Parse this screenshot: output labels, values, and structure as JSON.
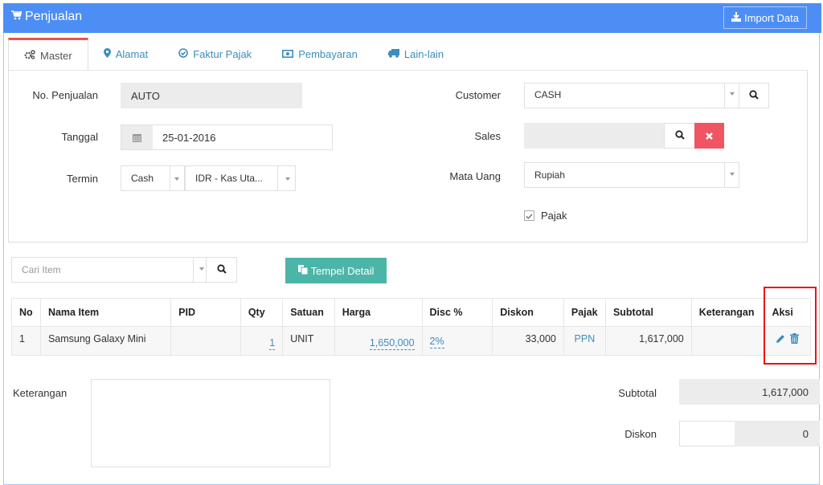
{
  "header": {
    "title": "Penjualan",
    "title_icon": "cart-icon",
    "import_button": "Import Data",
    "import_icon": "download-icon",
    "color": "#4d8ef5"
  },
  "tabs": [
    {
      "label": "Master",
      "icon": "cogs-icon",
      "active": true
    },
    {
      "label": "Alamat",
      "icon": "map-marker-icon",
      "active": false
    },
    {
      "label": "Faktur Pajak",
      "icon": "check-circle-icon",
      "active": false
    },
    {
      "label": "Pembayaran",
      "icon": "money-icon",
      "active": false
    },
    {
      "label": "Lain-lain",
      "icon": "truck-icon",
      "active": false
    }
  ],
  "form": {
    "no_penjualan": {
      "label": "No. Penjualan",
      "value": "AUTO"
    },
    "tanggal": {
      "label": "Tanggal",
      "value": "25-01-2016"
    },
    "termin": {
      "label": "Termin",
      "value": "Cash",
      "account": "IDR - Kas Uta..."
    },
    "customer": {
      "label": "Customer",
      "value": "CASH"
    },
    "sales": {
      "label": "Sales",
      "value": ""
    },
    "mata_uang": {
      "label": "Mata Uang",
      "value": "Rupiah"
    },
    "pajak": {
      "label": "Pajak",
      "checked": true
    }
  },
  "item_search": {
    "placeholder": "Cari Item"
  },
  "tempel_button": "Tempel Detail",
  "table": {
    "headers": [
      "No",
      "Nama Item",
      "PID",
      "Qty",
      "Satuan",
      "Harga",
      "Disc %",
      "Diskon",
      "Pajak",
      "Subtotal",
      "Keterangan",
      "Aksi"
    ],
    "rows": [
      {
        "no": "1",
        "nama": "Samsung Galaxy Mini",
        "pid": "",
        "qty": "1",
        "satuan": "UNIT",
        "harga": "1,650,000",
        "disc": "2%",
        "diskon": "33,000",
        "pajak": "PPN",
        "subtotal": "1,617,000",
        "keterangan": ""
      }
    ]
  },
  "footer": {
    "keterangan_label": "Keterangan",
    "keterangan_value": "",
    "subtotal_label": "Subtotal",
    "subtotal_value": "1,617,000",
    "diskon_label": "Diskon",
    "diskon_input": "",
    "diskon_value": "0"
  }
}
